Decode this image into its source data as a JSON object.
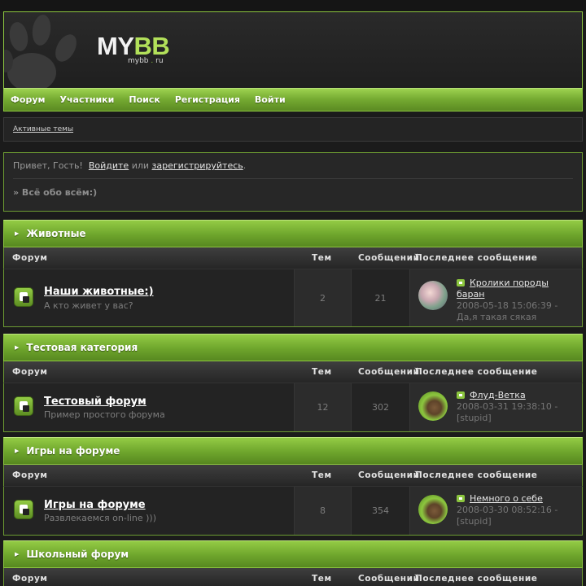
{
  "header": {
    "logo_my": "MY",
    "logo_bb": "BB",
    "logo_sub_left": "mybb",
    "logo_sub_dot": ".",
    "logo_sub_right": "ru"
  },
  "nav": {
    "items": [
      "Форум",
      "Участники",
      "Поиск",
      "Регистрация",
      "Войти"
    ]
  },
  "subnav": {
    "active_topics": "Активные темы"
  },
  "welcome": {
    "greeting": "Привет, Гость!",
    "login": "Войдите",
    "or": "или",
    "register": "зарегистрируйтесь",
    "period": ".",
    "breadcrumb": "» Всё обо всём:)"
  },
  "table_headers": {
    "forum": "Форум",
    "topics": "Тем",
    "posts": "Сообщений",
    "last": "Последнее сообщение"
  },
  "categories": [
    {
      "title": "Животные",
      "forum": {
        "name": "Наши животные:)",
        "desc": "А кто живет у вас?",
        "topics": "2",
        "posts": "21",
        "last_title_1": "Кролики породы",
        "last_title_2": "баран",
        "last_date": "2008-05-18 15:06:39 -",
        "last_author": "Да,я такая сякая",
        "avatar": "rabbit-avatar"
      }
    },
    {
      "title": "Тестовая категория",
      "forum": {
        "name": "Тестовый форум",
        "desc": "Пример простого форума",
        "topics": "12",
        "posts": "302",
        "last_title_1": "Флуд-Ветка",
        "last_date": "2008-03-31 19:38:10 -",
        "last_author": "[stupid]",
        "avatar": "dog-avatar"
      }
    },
    {
      "title": "Игры на форуме",
      "forum": {
        "name": "Игры на форуме",
        "desc": "Развлекаемся on-line )))",
        "topics": "8",
        "posts": "354",
        "last_title_1": "Немного о себе",
        "last_date": "2008-03-30 08:52:16 -",
        "last_author": "[stupid]",
        "avatar": "dog-avatar"
      }
    },
    {
      "title": "Школьный форум"
    }
  ],
  "colors": {
    "accent_green": "#8cc63f",
    "background": "#1b1b1b"
  }
}
